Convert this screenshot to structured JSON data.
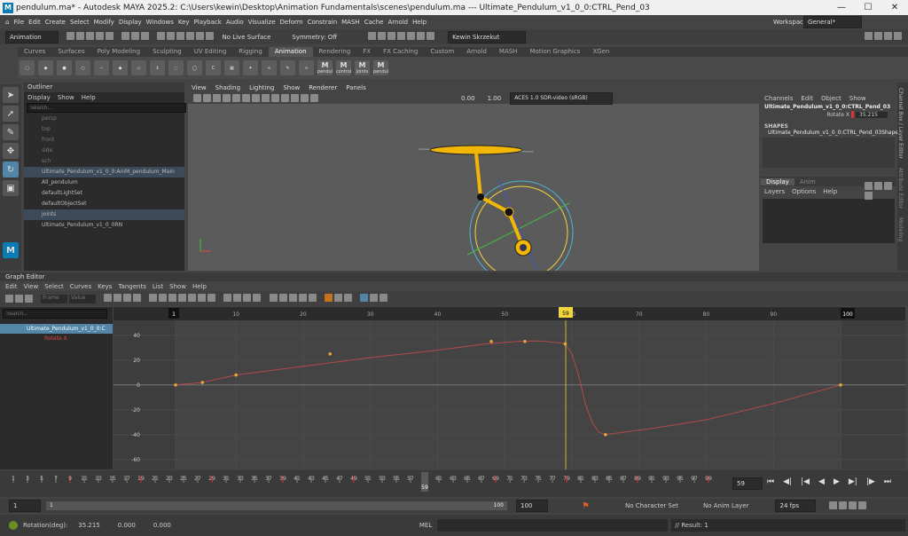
{
  "title_bar": {
    "logo": "M",
    "title": "pendulum.ma* - Autodesk MAYA 2025.2: C:\\Users\\kewin\\Desktop\\Animation Fundamentals\\scenes\\pendulum.ma   ---   Ultimate_Pendulum_v1_0_0:CTRL_Pend_03",
    "controls": [
      "—",
      "☐",
      "✕"
    ]
  },
  "menu": {
    "items": [
      "File",
      "Edit",
      "Create",
      "Select",
      "Modify",
      "Display",
      "Windows",
      "Key",
      "Playback",
      "Audio",
      "Visualize",
      "Deform",
      "Constrain",
      "MASH",
      "Cache",
      "Arnold",
      "Help"
    ],
    "workspace_label": "Workspace:",
    "workspace_value": "General*"
  },
  "status_line": {
    "menu_set": "Animation",
    "live_surface": "No Live Surface",
    "symmetry": "Symmetry: Off",
    "user": "Kewin Skrzekut"
  },
  "shelf": {
    "tabs": [
      "Curves",
      "Surfaces",
      "Poly Modeling",
      "Sculpting",
      "UV Editing",
      "Rigging",
      "Animation",
      "Rendering",
      "FX",
      "FX Caching",
      "Custom",
      "Arnold",
      "MASH",
      "Motion Graphics",
      "XGen"
    ],
    "active_tab": "Animation",
    "custom_buttons": [
      "pendul",
      "control",
      "joints",
      "pendul"
    ]
  },
  "outliner": {
    "title": "Outliner",
    "menu": [
      "Display",
      "Show",
      "Help"
    ],
    "search_placeholder": "Search...",
    "items": [
      {
        "label": "persp",
        "dim": true
      },
      {
        "label": "top",
        "dim": true
      },
      {
        "label": "front",
        "dim": true
      },
      {
        "label": "side",
        "dim": true
      },
      {
        "label": "sch",
        "dim": true
      },
      {
        "label": "Ultimate_Pendulum_v1_0_0:AniM_pendulum_Main",
        "dim": false,
        "selected": true
      },
      {
        "label": "All_pendulum",
        "dim": false
      },
      {
        "label": "defaultLightSet",
        "dim": false
      },
      {
        "label": "defaultObjectSet",
        "dim": false
      },
      {
        "label": "joints",
        "dim": false,
        "selected": true
      },
      {
        "label": "Ultimate_Pendulum_v1_0_0RN",
        "dim": false
      }
    ]
  },
  "viewport": {
    "menu": [
      "View",
      "Shading",
      "Lighting",
      "Show",
      "Renderer",
      "Panels"
    ],
    "field_a": "0.00",
    "field_b": "1.00",
    "color_space": "ACES 1.0 SDR-video (sRGB)"
  },
  "channel_box": {
    "menu": [
      "Channels",
      "Edit",
      "Object",
      "Show"
    ],
    "object": "Ultimate_Pendulum_v1_0_0:CTRL_Pend_03",
    "attr_label": "Rotate X",
    "attr_value": "35.215",
    "shapes_label": "SHAPES",
    "shape_name": "Ultimate_Pendulum_v1_0_0:CTRL_Pend_03Shape",
    "layer_tabs": [
      "Display",
      "Anim"
    ],
    "layer_menu": [
      "Layers",
      "Options",
      "Help"
    ],
    "side_tabs": [
      "Channel Box / Layer Editor",
      "Attribute Editor",
      "Modeling"
    ]
  },
  "graph_editor": {
    "title": "Graph Editor",
    "menu": [
      "Edit",
      "View",
      "Select",
      "Curves",
      "Keys",
      "Tangents",
      "List",
      "Show",
      "Help"
    ],
    "frame_placeholder": "Frame",
    "value_placeholder": "Value",
    "search_placeholder": "Search...",
    "tree_item": "Ultimate_Pendulum_v1_0_0:C",
    "tree_attr": "Rotate X",
    "frame_ticks": [
      "1",
      "10",
      "20",
      "30",
      "40",
      "50",
      "60",
      "70",
      "80",
      "90",
      "100"
    ],
    "value_ticks": [
      "40",
      "20",
      "0",
      "-20",
      "-40",
      "-60"
    ],
    "current_frame": "59",
    "curve_color": "#b34a4a"
  },
  "timeline": {
    "ticks": [
      "1",
      "3",
      "5",
      "7",
      "9",
      "11",
      "13",
      "15",
      "17",
      "19",
      "21",
      "23",
      "25",
      "27",
      "29",
      "31",
      "33",
      "35",
      "37",
      "39",
      "41",
      "43",
      "45",
      "47",
      "49",
      "51",
      "53",
      "55",
      "57",
      "59",
      "61",
      "63",
      "65",
      "67",
      "69",
      "71",
      "73",
      "75",
      "77",
      "79",
      "81",
      "83",
      "85",
      "87",
      "89",
      "91",
      "93",
      "95",
      "97",
      "99"
    ],
    "current_frame": "59",
    "frame_field": "59"
  },
  "range": {
    "start": "1",
    "inner_start": "1",
    "inner_end": "100",
    "end": "100",
    "character_set": "No Character Set",
    "anim_layer": "No Anim Layer",
    "fps": "24 fps"
  },
  "help_line": {
    "label": "Rotation(deg):",
    "v1": "35.215",
    "v2": "0.000",
    "v3": "0.000",
    "mel": "MEL",
    "result": "// Result: 1"
  }
}
